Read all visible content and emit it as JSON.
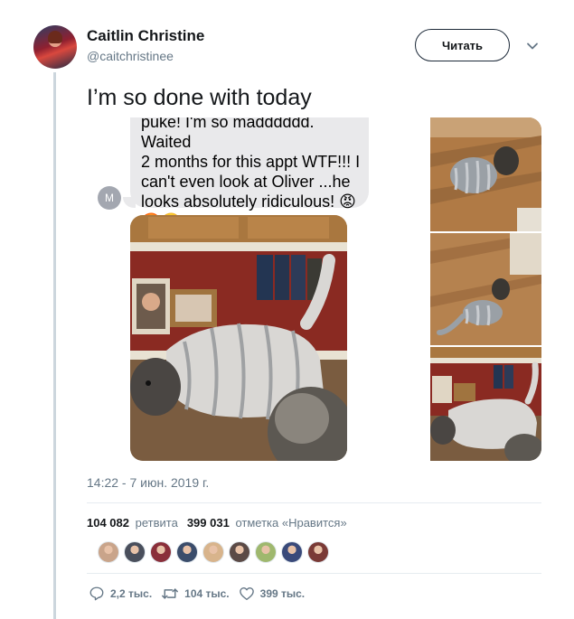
{
  "tweet": {
    "display_name": "Caitlin Christine",
    "handle": "@caitchristinee",
    "follow_label": "Читать",
    "text": "I’m so done with today",
    "timestamp": "14:22 - 7 июн. 2019 г.",
    "icons": [
      "caret-down-icon",
      "reply-icon",
      "retweet-icon",
      "like-icon"
    ]
  },
  "media": {
    "message_lines": [
      "puke! I'm so madddddd. Waited",
      "2 months for this appt WTF!!! I",
      "can't even look at Oliver ...he",
      "looks absolutely ridiculous! 😡",
      "🤬🙄 !!!!!!!!!!"
    ],
    "sender_initial": "M"
  },
  "stats": {
    "retweets_count": "104 082",
    "retweets_label": "ретвита",
    "likes_count": "399 031",
    "likes_label": "отметка «Нравится»"
  },
  "likers": [
    "#c9a48a",
    "#4a4f5c",
    "#8a2f3a",
    "#3b4d6b",
    "#d8b48c",
    "#5b4a46",
    "#9fb86e",
    "#3a4a7a",
    "#7a3a36"
  ],
  "actions": {
    "replies": "2,2 тыс.",
    "retweets": "104 тыс.",
    "likes": "399 тыс."
  }
}
